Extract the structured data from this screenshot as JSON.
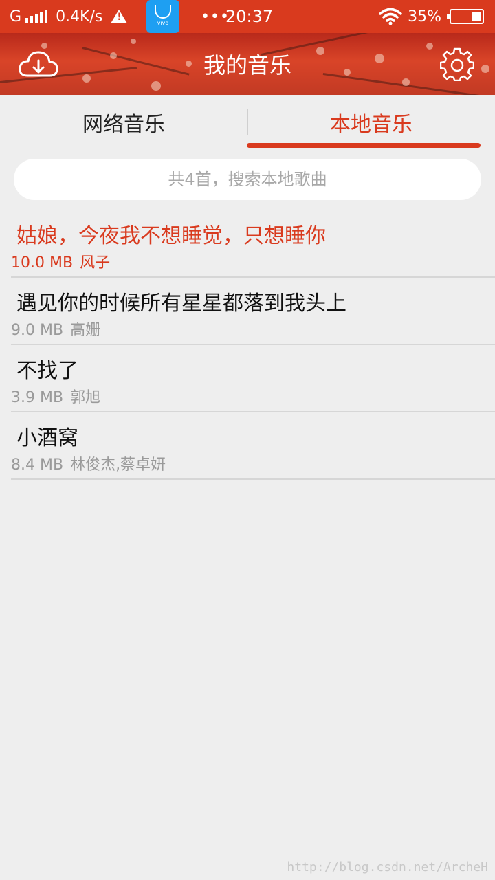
{
  "status_bar": {
    "network": "G",
    "speed": "0.4K/s",
    "app_icon_label": "vivo",
    "dots": "•••",
    "time": "20:37",
    "battery": "35%",
    "battery_level": 0.35,
    "icons": [
      "signal-icon",
      "warning-icon",
      "vivo-store-icon",
      "wifi-icon",
      "battery-icon"
    ]
  },
  "header": {
    "title": "我的音乐",
    "download_icon": "cloud-download-icon",
    "settings_icon": "gear-icon"
  },
  "tabs": [
    {
      "label": "网络音乐",
      "active": false
    },
    {
      "label": "本地音乐",
      "active": true
    }
  ],
  "search": {
    "placeholder": "共4首，搜索本地歌曲"
  },
  "songs": [
    {
      "title": "姑娘，今夜我不想睡觉，只想睡你",
      "size": "10.0 MB",
      "artist": "风子",
      "active": true
    },
    {
      "title": "遇见你的时候所有星星都落到我头上",
      "size": "9.0 MB",
      "artist": "高姗",
      "active": false
    },
    {
      "title": "不找了",
      "size": "3.9 MB",
      "artist": "郭旭",
      "active": false
    },
    {
      "title": "小酒窝",
      "size": "8.4 MB",
      "artist": "林俊杰,蔡卓妍",
      "active": false
    }
  ],
  "watermark": "http://blog.csdn.net/ArcheH",
  "colors": {
    "accent": "#d93a1e",
    "background": "#eeeeee",
    "secondary_text": "#9a9a9a"
  }
}
